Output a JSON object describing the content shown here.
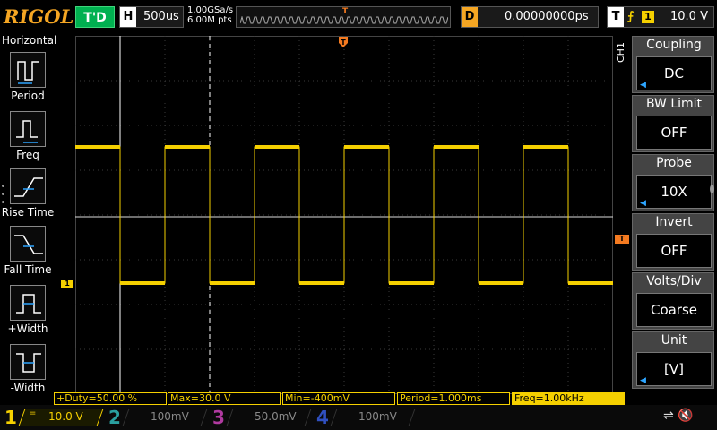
{
  "header": {
    "logo": "RIGOL",
    "run_status": "T'D",
    "timebase_tag": "H",
    "timebase": "500us",
    "sample_rate": "1.00GSa/s",
    "memory_depth": "6.00M pts",
    "trig_pos_marker": "T",
    "delay_tag": "D",
    "delay": "0.00000000ps",
    "trigger_tag": "T",
    "trigger_edge": "⨍",
    "trigger_source": "1",
    "trigger_level": "10.0 V"
  },
  "left_menu": {
    "title": "Horizontal",
    "items": [
      {
        "label": "Period",
        "icon": "period-icon"
      },
      {
        "label": "Freq",
        "icon": "freq-icon"
      },
      {
        "label": "Rise Time",
        "icon": "rise-time-icon"
      },
      {
        "label": "Fall Time",
        "icon": "fall-time-icon"
      },
      {
        "label": "+Width",
        "icon": "pos-width-icon"
      },
      {
        "label": "-Width",
        "icon": "neg-width-icon"
      }
    ]
  },
  "right_menu": {
    "channel_label": "CH1",
    "items": [
      {
        "title": "Coupling",
        "value": "DC",
        "has_arrow": true
      },
      {
        "title": "BW Limit",
        "value": "OFF",
        "has_arrow": false
      },
      {
        "title": "Probe",
        "value": "10X",
        "has_arrow": true
      },
      {
        "title": "Invert",
        "value": "OFF",
        "has_arrow": false
      },
      {
        "title": "Volts/Div",
        "value": "Coarse",
        "has_arrow": false
      },
      {
        "title": "Unit",
        "value": "[V]",
        "has_arrow": true
      }
    ]
  },
  "markers": {
    "top_trigger": "T",
    "right_trigger_level": "T",
    "channel1_ground": "1"
  },
  "measurements": [
    "+Duty=50.00 %",
    "Max=30.0 V",
    "Min=-400mV",
    "Period=1.000ms",
    "Freq=1.00kHz"
  ],
  "channels": [
    {
      "num": "1",
      "coupling": "=",
      "scale": "10.0 V",
      "color": "#f5d000",
      "active": true
    },
    {
      "num": "2",
      "coupling": "",
      "scale": "100mV",
      "color": "#2aa0a0",
      "active": false
    },
    {
      "num": "3",
      "coupling": "",
      "scale": "50.0mV",
      "color": "#b03aa0",
      "active": false
    },
    {
      "num": "4",
      "coupling": "",
      "scale": "100mV",
      "color": "#3050c0",
      "active": false
    }
  ],
  "status_icons": [
    "usb-icon",
    "speaker-icon"
  ],
  "colors": {
    "ch1": "#f5d000",
    "trigger": "#f47a20",
    "run_status": "#00b050",
    "logo": "#f5a623",
    "menu_arrow": "#2da5ff"
  },
  "waveform": {
    "type": "square",
    "frequency": "1.00kHz",
    "duty": "50%",
    "high_level_v": 30.0,
    "low_level_v": -0.4,
    "volts_per_div": 10.0,
    "time_per_div_us": 500
  }
}
